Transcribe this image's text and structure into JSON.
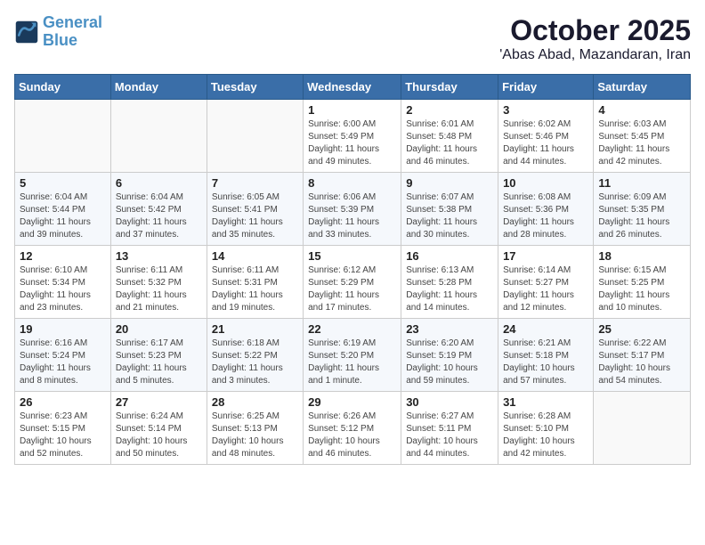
{
  "header": {
    "logo_line1": "General",
    "logo_line2": "Blue",
    "month": "October 2025",
    "location": "'Abas Abad, Mazandaran, Iran"
  },
  "weekdays": [
    "Sunday",
    "Monday",
    "Tuesday",
    "Wednesday",
    "Thursday",
    "Friday",
    "Saturday"
  ],
  "weeks": [
    [
      {
        "day": "",
        "info": ""
      },
      {
        "day": "",
        "info": ""
      },
      {
        "day": "",
        "info": ""
      },
      {
        "day": "1",
        "info": "Sunrise: 6:00 AM\nSunset: 5:49 PM\nDaylight: 11 hours and 49 minutes."
      },
      {
        "day": "2",
        "info": "Sunrise: 6:01 AM\nSunset: 5:48 PM\nDaylight: 11 hours and 46 minutes."
      },
      {
        "day": "3",
        "info": "Sunrise: 6:02 AM\nSunset: 5:46 PM\nDaylight: 11 hours and 44 minutes."
      },
      {
        "day": "4",
        "info": "Sunrise: 6:03 AM\nSunset: 5:45 PM\nDaylight: 11 hours and 42 minutes."
      }
    ],
    [
      {
        "day": "5",
        "info": "Sunrise: 6:04 AM\nSunset: 5:44 PM\nDaylight: 11 hours and 39 minutes."
      },
      {
        "day": "6",
        "info": "Sunrise: 6:04 AM\nSunset: 5:42 PM\nDaylight: 11 hours and 37 minutes."
      },
      {
        "day": "7",
        "info": "Sunrise: 6:05 AM\nSunset: 5:41 PM\nDaylight: 11 hours and 35 minutes."
      },
      {
        "day": "8",
        "info": "Sunrise: 6:06 AM\nSunset: 5:39 PM\nDaylight: 11 hours and 33 minutes."
      },
      {
        "day": "9",
        "info": "Sunrise: 6:07 AM\nSunset: 5:38 PM\nDaylight: 11 hours and 30 minutes."
      },
      {
        "day": "10",
        "info": "Sunrise: 6:08 AM\nSunset: 5:36 PM\nDaylight: 11 hours and 28 minutes."
      },
      {
        "day": "11",
        "info": "Sunrise: 6:09 AM\nSunset: 5:35 PM\nDaylight: 11 hours and 26 minutes."
      }
    ],
    [
      {
        "day": "12",
        "info": "Sunrise: 6:10 AM\nSunset: 5:34 PM\nDaylight: 11 hours and 23 minutes."
      },
      {
        "day": "13",
        "info": "Sunrise: 6:11 AM\nSunset: 5:32 PM\nDaylight: 11 hours and 21 minutes."
      },
      {
        "day": "14",
        "info": "Sunrise: 6:11 AM\nSunset: 5:31 PM\nDaylight: 11 hours and 19 minutes."
      },
      {
        "day": "15",
        "info": "Sunrise: 6:12 AM\nSunset: 5:29 PM\nDaylight: 11 hours and 17 minutes."
      },
      {
        "day": "16",
        "info": "Sunrise: 6:13 AM\nSunset: 5:28 PM\nDaylight: 11 hours and 14 minutes."
      },
      {
        "day": "17",
        "info": "Sunrise: 6:14 AM\nSunset: 5:27 PM\nDaylight: 11 hours and 12 minutes."
      },
      {
        "day": "18",
        "info": "Sunrise: 6:15 AM\nSunset: 5:25 PM\nDaylight: 11 hours and 10 minutes."
      }
    ],
    [
      {
        "day": "19",
        "info": "Sunrise: 6:16 AM\nSunset: 5:24 PM\nDaylight: 11 hours and 8 minutes."
      },
      {
        "day": "20",
        "info": "Sunrise: 6:17 AM\nSunset: 5:23 PM\nDaylight: 11 hours and 5 minutes."
      },
      {
        "day": "21",
        "info": "Sunrise: 6:18 AM\nSunset: 5:22 PM\nDaylight: 11 hours and 3 minutes."
      },
      {
        "day": "22",
        "info": "Sunrise: 6:19 AM\nSunset: 5:20 PM\nDaylight: 11 hours and 1 minute."
      },
      {
        "day": "23",
        "info": "Sunrise: 6:20 AM\nSunset: 5:19 PM\nDaylight: 10 hours and 59 minutes."
      },
      {
        "day": "24",
        "info": "Sunrise: 6:21 AM\nSunset: 5:18 PM\nDaylight: 10 hours and 57 minutes."
      },
      {
        "day": "25",
        "info": "Sunrise: 6:22 AM\nSunset: 5:17 PM\nDaylight: 10 hours and 54 minutes."
      }
    ],
    [
      {
        "day": "26",
        "info": "Sunrise: 6:23 AM\nSunset: 5:15 PM\nDaylight: 10 hours and 52 minutes."
      },
      {
        "day": "27",
        "info": "Sunrise: 6:24 AM\nSunset: 5:14 PM\nDaylight: 10 hours and 50 minutes."
      },
      {
        "day": "28",
        "info": "Sunrise: 6:25 AM\nSunset: 5:13 PM\nDaylight: 10 hours and 48 minutes."
      },
      {
        "day": "29",
        "info": "Sunrise: 6:26 AM\nSunset: 5:12 PM\nDaylight: 10 hours and 46 minutes."
      },
      {
        "day": "30",
        "info": "Sunrise: 6:27 AM\nSunset: 5:11 PM\nDaylight: 10 hours and 44 minutes."
      },
      {
        "day": "31",
        "info": "Sunrise: 6:28 AM\nSunset: 5:10 PM\nDaylight: 10 hours and 42 minutes."
      },
      {
        "day": "",
        "info": ""
      }
    ]
  ]
}
